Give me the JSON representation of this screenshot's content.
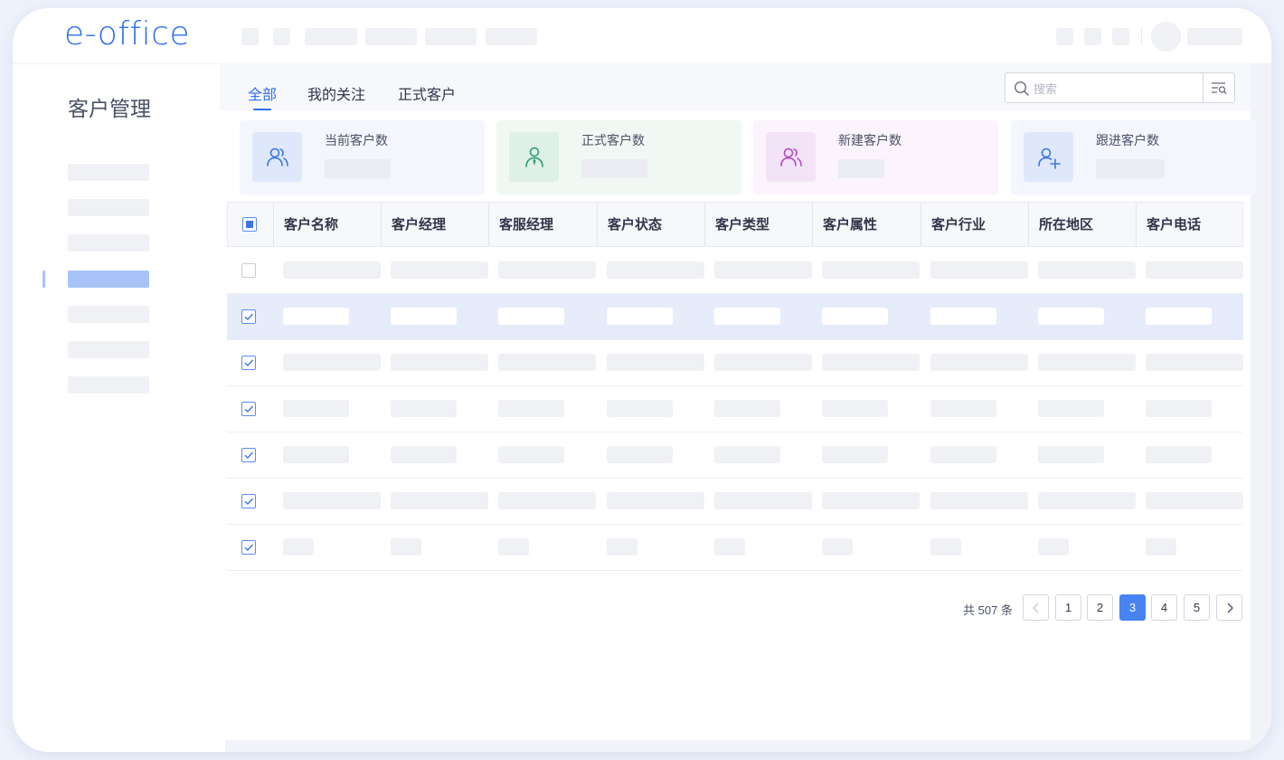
{
  "brand": {
    "logo_text": "e-office"
  },
  "sidebar": {
    "title": "客户管理"
  },
  "tabs": [
    {
      "label": "全部",
      "active": true
    },
    {
      "label": "我的关注",
      "active": false
    },
    {
      "label": "正式客户",
      "active": false
    }
  ],
  "search": {
    "placeholder": "搜索",
    "value": ""
  },
  "stats": [
    {
      "label": "当前客户数",
      "icon": "users-icon",
      "color": "#3d74e6",
      "bg": "#e6eefc"
    },
    {
      "label": "正式客户数",
      "icon": "user-tie-icon",
      "color": "#2a9d6f",
      "bg": "#e2f2ea"
    },
    {
      "label": "新建客户数",
      "icon": "users-icon",
      "color": "#b448c9",
      "bg": "#f4e6f7"
    },
    {
      "label": "跟进客户数",
      "icon": "user-add-icon",
      "color": "#3d74e6",
      "bg": "#e6eefc"
    }
  ],
  "table": {
    "columns": [
      "客户名称",
      "客户经理",
      "客服经理",
      "客户状态",
      "客户类型",
      "客户属性",
      "客户行业",
      "所在地区",
      "客户电话"
    ],
    "rows": [
      {
        "checked": false,
        "selected": false,
        "style": "long"
      },
      {
        "checked": true,
        "selected": true,
        "style": "medium"
      },
      {
        "checked": true,
        "selected": false,
        "style": "long"
      },
      {
        "checked": true,
        "selected": false,
        "style": "medium"
      },
      {
        "checked": true,
        "selected": false,
        "style": "medium"
      },
      {
        "checked": true,
        "selected": false,
        "style": "long"
      },
      {
        "checked": true,
        "selected": false,
        "style": "short"
      }
    ]
  },
  "pagination": {
    "total_label": "共 507 条",
    "pages": [
      "1",
      "2",
      "3",
      "4",
      "5"
    ],
    "current": "3",
    "prev": "prev",
    "next": "next"
  },
  "colors": {
    "accent": "#2f6fec",
    "active_page": "#4784f2",
    "selected_row": "#e6ecfa"
  }
}
